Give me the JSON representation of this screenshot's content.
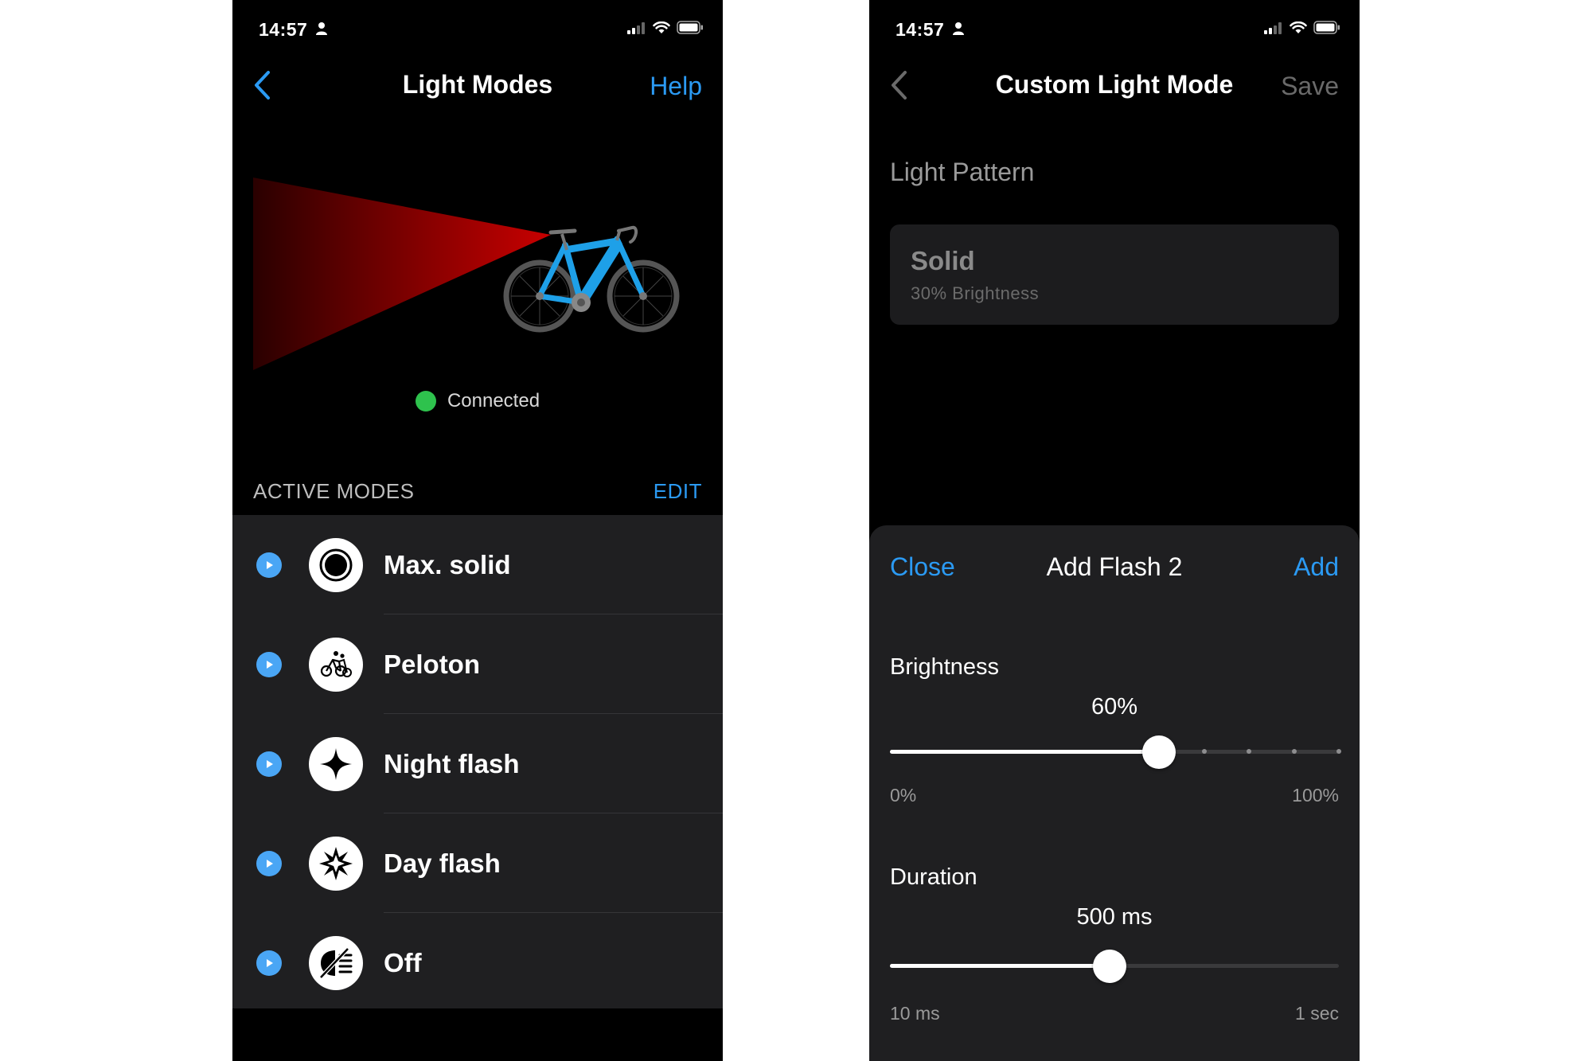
{
  "left": {
    "status": {
      "time": "14:57"
    },
    "nav": {
      "title": "Light Modes",
      "help_label": "Help"
    },
    "connection": {
      "status_text": "Connected",
      "status_color": "#2ec24d"
    },
    "section": {
      "title": "ACTIVE MODES",
      "edit_label": "EDIT"
    },
    "modes": [
      {
        "label": "Max. solid",
        "icon": "max-solid-icon"
      },
      {
        "label": "Peloton",
        "icon": "peloton-icon"
      },
      {
        "label": "Night flash",
        "icon": "night-flash-icon"
      },
      {
        "label": "Day flash",
        "icon": "day-flash-icon"
      },
      {
        "label": "Off",
        "icon": "light-off-icon"
      }
    ]
  },
  "right": {
    "status": {
      "time": "14:57"
    },
    "nav": {
      "title": "Custom Light Mode",
      "save_label": "Save"
    },
    "pattern": {
      "heading": "Light Pattern",
      "name": "Solid",
      "subtitle": "30% Brightness"
    },
    "sheet": {
      "close_label": "Close",
      "title": "Add Flash 2",
      "add_label": "Add",
      "brightness": {
        "label": "Brightness",
        "value_text": "60%",
        "value_fraction": 0.6,
        "min_label": "0%",
        "max_label": "100%"
      },
      "duration": {
        "label": "Duration",
        "value_text": "500 ms",
        "value_fraction": 0.49,
        "min_label": "10 ms",
        "max_label": "1 sec"
      }
    }
  },
  "colors": {
    "accent": "#2b9af3",
    "background": "#000000",
    "card": "#1f1f21",
    "bike_frame": "#1ea0e8",
    "beam": "#c00000"
  }
}
